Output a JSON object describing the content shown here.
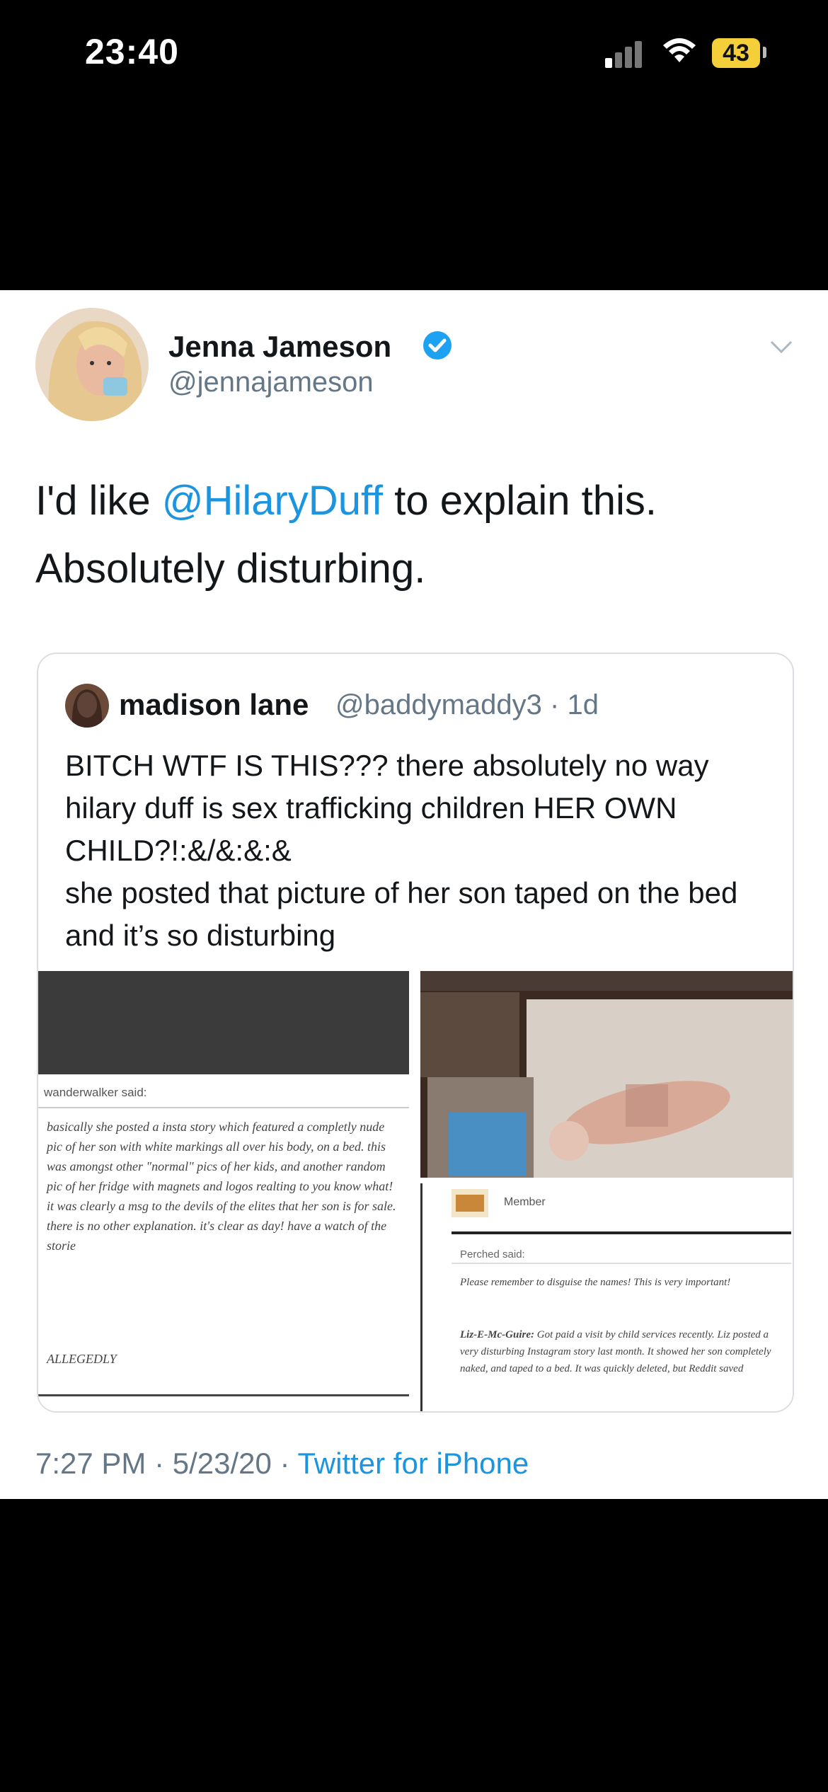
{
  "status_bar": {
    "time": "23:40",
    "battery": "43"
  },
  "tweet": {
    "name": "Jenna Jameson",
    "handle": "@jennajameson",
    "text_before": "I'd like ",
    "mention": "@HilaryDuff",
    "text_after": " to explain this. Absolutely disturbing.",
    "timestamp": "7:27 PM · 5/23/20 · ",
    "source": "Twitter for iPhone"
  },
  "quote": {
    "name": "madison lane",
    "handle_time": "@baddymaddy3 · 1d",
    "line1": "BITCH WTF IS THIS??? there absolutely no way hilary duff is sex trafficking children HER OWN CHILD?!:&/&:&:&",
    "line2": "she posted that picture of her son taped on the bed and it’s so disturbing"
  },
  "left_image": {
    "said": "wanderwalker said:",
    "body": "basically she posted a insta story which featured a completly nude pic of her son with white markings all over his body, on a bed. this was amongst other \"normal\" pics of her kids, and another random pic of her fridge with magnets and logos realting to you know what! it was clearly a msg to the devils of the elites that her son is for sale. there is no other explanation. it's clear as day! have a watch of the storie",
    "allegedly": "ALLEGEDLY"
  },
  "right_image": {
    "member": "Member",
    "perched": "Perched said:",
    "body1": "Please remember to disguise the names! This is very important!",
    "body2_name": "Liz-E-Mc-Guire:",
    "body2": " Got paid a visit by child services recently. Liz posted a very disturbing Instagram story last month. It showed her son completely naked, and taped to a bed. It was quickly deleted, but Reddit saved"
  },
  "colors": {
    "link": "#1b95e0",
    "verified": "#1da1f2",
    "muted": "#657786"
  }
}
